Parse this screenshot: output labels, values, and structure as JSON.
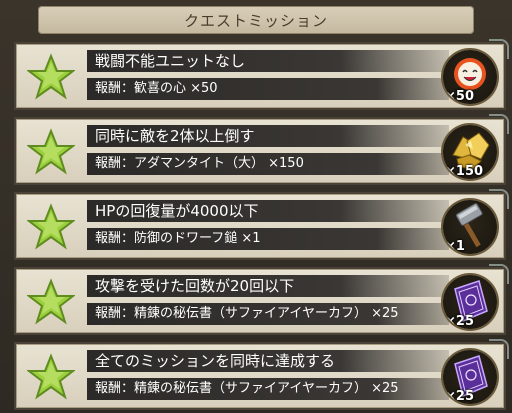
{
  "header": {
    "title": "クエストミッション"
  },
  "missions": [
    {
      "title": "戦闘不能ユニットなし",
      "reward_label": "報酬：歓喜の心 ×50",
      "qty": "×50",
      "icon": "joy-heart-mask-icon"
    },
    {
      "title": "同時に敵を2体以上倒す",
      "reward_label": "報酬：アダマンタイト（大） ×150",
      "qty": "×150",
      "icon": "adamantite-ore-icon"
    },
    {
      "title": "HPの回復量が4000以下",
      "reward_label": "報酬：防御のドワーフ鎚 ×1",
      "qty": "×1",
      "icon": "dwarf-hammer-icon"
    },
    {
      "title": "攻撃を受けた回数が20回以下",
      "reward_label": "報酬：精錬の秘伝書（サファイアイヤーカフ） ×25",
      "qty": "×25",
      "icon": "secret-book-icon"
    },
    {
      "title": "全てのミッションを同時に達成する",
      "reward_label": "報酬：精錬の秘伝書（サファイアイヤーカフ） ×25",
      "qty": "×25",
      "icon": "secret-book-icon"
    }
  ],
  "colors": {
    "star": "#9ccf3e",
    "card_bg": "#e8e2d2",
    "bar_bg": "#2c2a28"
  }
}
